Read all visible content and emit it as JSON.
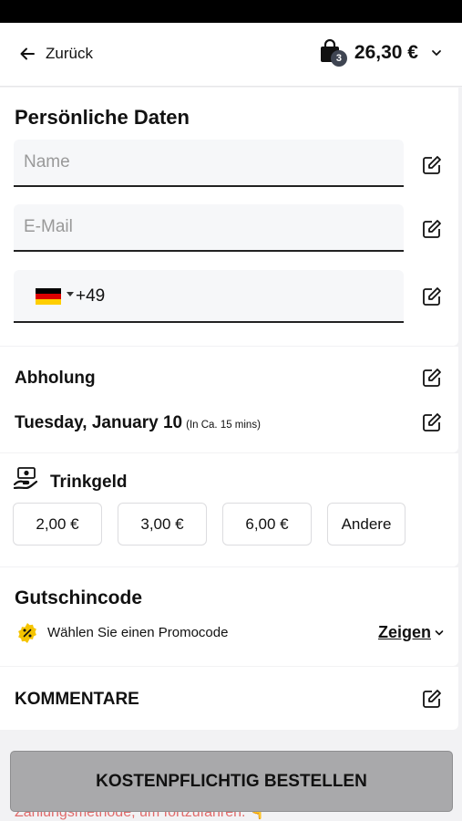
{
  "header": {
    "back_label": "Zurück",
    "cart_count": "3",
    "cart_total": "26,30 €"
  },
  "personal": {
    "title": "Persönliche Daten",
    "name_placeholder": "Name",
    "email_placeholder": "E-Mail",
    "phone_code": "+49",
    "phone_country": "Germany"
  },
  "pickup": {
    "title": "Abholung",
    "date": "Tuesday, January 10",
    "eta": "(In Ca. 15 mins)"
  },
  "tip": {
    "title": "Trinkgeld",
    "options": [
      "2,00 €",
      "3,00 €",
      "6,00 €",
      "Andere"
    ]
  },
  "voucher": {
    "title": "Gutschincode",
    "label": "Wählen Sie einen Promocode",
    "show": "Zeigen"
  },
  "comments": {
    "title": "KOMMENTARE"
  },
  "footer": {
    "hint": "Zahlungsmethode, um fortzufahren. 👇",
    "submit": "KOSTENPFLICHTIG BESTELLEN"
  },
  "colors": {
    "submit_bg": "#a9a9ab",
    "hint": "#e06b6b",
    "badge": "#3f4552",
    "promo_icon": "#f5c400"
  }
}
